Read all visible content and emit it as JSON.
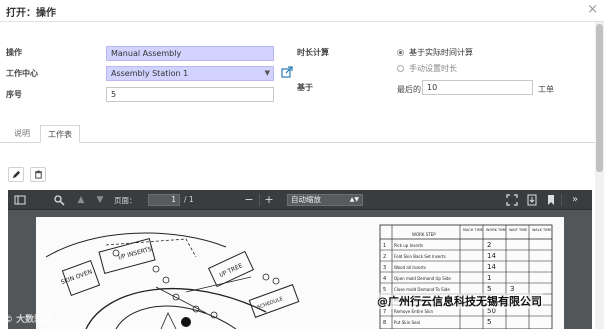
{
  "dialog": {
    "title": "打开：操作",
    "close_glyph": "×"
  },
  "form": {
    "operation_label": "操作",
    "operation_value": "Manual Assembly",
    "workcenter_label": "工作中心",
    "workcenter_value": "Assembly Station 1",
    "sequence_label": "序号",
    "sequence_value": "5",
    "duration_label": "时长计算",
    "duration_options": [
      {
        "label": "基于实际时间计算",
        "selected": true
      },
      {
        "label": "手动设置时长",
        "selected": false
      }
    ],
    "based_on_label": "基于",
    "last_label": "最后的",
    "last_value": "10",
    "unit_label": "工单"
  },
  "tabs": [
    {
      "label": "说明",
      "active": false
    },
    {
      "label": "工作表",
      "active": true
    }
  ],
  "actions": {
    "edit_icon": "pencil-icon",
    "delete_icon": "trash-icon"
  },
  "pdf_viewer": {
    "page_label": "页面：",
    "page_value": "1",
    "page_total": "/ 1",
    "zoom_value": "自动缩放",
    "zoom_out": "−",
    "zoom_in": "+"
  },
  "document": {
    "col_headers": [
      "WORK STEP",
      "MACH TIME",
      "WORK TIME",
      "WAIT TIME",
      "WALK TIME"
    ],
    "rows": [
      [
        "1",
        "Pick up Inserts",
        "",
        "2",
        "",
        ""
      ],
      [
        "2",
        "Fold Skin Back Set Inserts",
        "",
        "14",
        "",
        ""
      ],
      [
        "3",
        "Wood all Inserts",
        "",
        "14",
        "",
        ""
      ],
      [
        "4",
        "Open mold Demand Up Side",
        "",
        "1",
        "",
        ""
      ],
      [
        "5",
        "Close mold Demand To Side",
        "",
        "5",
        "3",
        ""
      ],
      [
        "6",
        "Process Tubes",
        "",
        "3",
        "",
        ""
      ],
      [
        "7",
        "Remove Entire Skin",
        "",
        "50",
        "",
        ""
      ],
      [
        "8",
        "Put Skin Seal",
        "",
        "5",
        "",
        ""
      ]
    ],
    "diagram_labels": [
      "SKIN OVEN",
      "I/P INSERTS",
      "I/P TREE",
      "SCHEDULE",
      "Quarter"
    ]
  },
  "watermarks": {
    "left": "© 大数驱动",
    "right": "@广州行云信息科技无锡有限公司"
  },
  "colors": {
    "required_field_bg": "#d2d2ff",
    "viewer_bg": "#525659",
    "toolbar_bg": "#3a3d40",
    "link_icon": "#2a7ab5"
  }
}
